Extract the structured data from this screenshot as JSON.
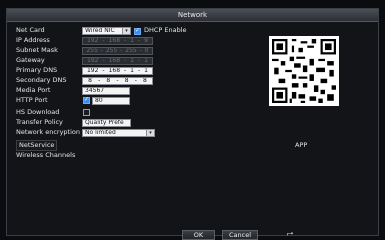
{
  "window": {
    "title": "Network"
  },
  "form": {
    "net_card": {
      "label": "Net Card",
      "value": "Wired NIC",
      "dhcp_label": "DHCP Enable",
      "dhcp_checked": true
    },
    "ip_address": {
      "label": "IP Address",
      "octets": [
        "192",
        "168",
        "1",
        "9"
      ]
    },
    "subnet_mask": {
      "label": "Subnet Mask",
      "octets": [
        "255",
        "255",
        "255",
        "0"
      ]
    },
    "gateway": {
      "label": "Gateway",
      "octets": [
        "192",
        "168",
        "1",
        "1"
      ]
    },
    "primary_dns": {
      "label": "Primary DNS",
      "octets": [
        "192",
        "168",
        "1",
        "1"
      ]
    },
    "secondary_dns": {
      "label": "Secondary DNS",
      "octets": [
        "8",
        "8",
        "8",
        "8"
      ]
    },
    "media_port": {
      "label": "Media Port",
      "value": "34567"
    },
    "http_port": {
      "label": "HTTP Port",
      "value": "80",
      "checked": true
    },
    "hs_download": {
      "label": "HS Download",
      "checked": false
    },
    "transfer_policy": {
      "label": "Transfer Policy",
      "value": "Quality Prefe"
    },
    "network_encryption": {
      "label": "Network encryption",
      "value": "No limited"
    }
  },
  "links": {
    "net_service": "NetService",
    "wireless_channels": "Wireless Channels"
  },
  "qr": {
    "label": "APP"
  },
  "buttons": {
    "ok": "OK",
    "cancel": "Cancel"
  }
}
